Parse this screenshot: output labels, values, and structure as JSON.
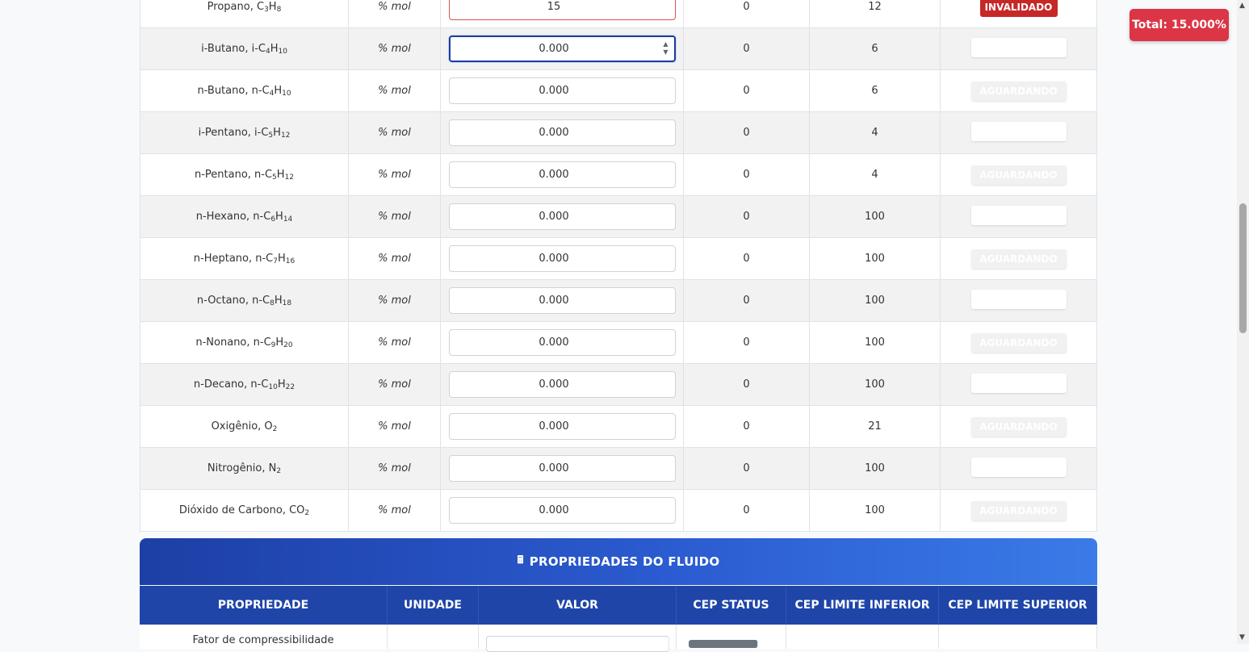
{
  "total_badge": "Total: 15.000%",
  "components": [
    {
      "name": "Propano, C",
      "f": [
        [
          "3",
          "sub"
        ],
        [
          "H",
          ""
        ],
        [
          "8",
          "sub"
        ]
      ],
      "unit": "% mol",
      "value": "15",
      "lower": "0",
      "upper": "12",
      "status": "INVALIDADO",
      "state": "invalid"
    },
    {
      "name": "i-Butano, i-C",
      "f": [
        [
          "4",
          "sub"
        ],
        [
          "H",
          ""
        ],
        [
          "10",
          "sub"
        ]
      ],
      "unit": "% mol",
      "value": "0.000",
      "lower": "0",
      "upper": "6",
      "status": "",
      "state": "focused"
    },
    {
      "name": "n-Butano, n-C",
      "f": [
        [
          "4",
          "sub"
        ],
        [
          "H",
          ""
        ],
        [
          "10",
          "sub"
        ]
      ],
      "unit": "% mol",
      "value": "0.000",
      "lower": "0",
      "upper": "6",
      "status": "AGUARDANDO",
      "state": "waiting"
    },
    {
      "name": "i-Pentano, i-C",
      "f": [
        [
          "5",
          "sub"
        ],
        [
          "H",
          ""
        ],
        [
          "12",
          "sub"
        ]
      ],
      "unit": "% mol",
      "value": "0.000",
      "lower": "0",
      "upper": "4",
      "status": "",
      "state": "blank"
    },
    {
      "name": "n-Pentano, n-C",
      "f": [
        [
          "5",
          "sub"
        ],
        [
          "H",
          ""
        ],
        [
          "12",
          "sub"
        ]
      ],
      "unit": "% mol",
      "value": "0.000",
      "lower": "0",
      "upper": "4",
      "status": "AGUARDANDO",
      "state": "waiting"
    },
    {
      "name": "n-Hexano, n-C",
      "f": [
        [
          "6",
          "sub"
        ],
        [
          "H",
          ""
        ],
        [
          "14",
          "sub"
        ]
      ],
      "unit": "% mol",
      "value": "0.000",
      "lower": "0",
      "upper": "100",
      "status": "",
      "state": "blank"
    },
    {
      "name": "n-Heptano, n-C",
      "f": [
        [
          "7",
          "sub"
        ],
        [
          "H",
          ""
        ],
        [
          "16",
          "sub"
        ]
      ],
      "unit": "% mol",
      "value": "0.000",
      "lower": "0",
      "upper": "100",
      "status": "AGUARDANDO",
      "state": "waiting"
    },
    {
      "name": "n-Octano, n-C",
      "f": [
        [
          "8",
          "sub"
        ],
        [
          "H",
          ""
        ],
        [
          "18",
          "sub"
        ]
      ],
      "unit": "% mol",
      "value": "0.000",
      "lower": "0",
      "upper": "100",
      "status": "",
      "state": "blank"
    },
    {
      "name": "n-Nonano, n-C",
      "f": [
        [
          "9",
          "sub"
        ],
        [
          "H",
          ""
        ],
        [
          "20",
          "sub"
        ]
      ],
      "unit": "% mol",
      "value": "0.000",
      "lower": "0",
      "upper": "100",
      "status": "AGUARDANDO",
      "state": "waiting"
    },
    {
      "name": "n-Decano, n-C",
      "f": [
        [
          "10",
          "sub"
        ],
        [
          "H",
          ""
        ],
        [
          "22",
          "sub"
        ]
      ],
      "unit": "% mol",
      "value": "0.000",
      "lower": "0",
      "upper": "100",
      "status": "",
      "state": "blank"
    },
    {
      "name": "Oxigênio, O",
      "f": [
        [
          "2",
          "sub"
        ]
      ],
      "unit": "% mol",
      "value": "0.000",
      "lower": "0",
      "upper": "21",
      "status": "AGUARDANDO",
      "state": "waiting"
    },
    {
      "name": "Nitrogênio, N",
      "f": [
        [
          "2",
          "sub"
        ]
      ],
      "unit": "% mol",
      "value": "0.000",
      "lower": "0",
      "upper": "100",
      "status": "",
      "state": "blank"
    },
    {
      "name": "Dióxido de Carbono, CO",
      "f": [
        [
          "2",
          "sub"
        ]
      ],
      "unit": "% mol",
      "value": "0.000",
      "lower": "0",
      "upper": "100",
      "status": "AGUARDANDO",
      "state": "waiting"
    }
  ],
  "fluid_section": {
    "title": "PROPRIEDADES DO FLUIDO",
    "icon": "calculator-icon",
    "headers": [
      "PROPRIEDADE",
      "UNIDADE",
      "VALOR",
      "CEP STATUS",
      "CEP LIMITE INFERIOR",
      "CEP LIMITE SUPERIOR"
    ],
    "first_row_label": "Fator de compressibilidade"
  },
  "colors": {
    "header_dark": "#1d3fa5",
    "header_light": "#3a7be8",
    "invalid": "#c62828",
    "total": "#dc3545"
  }
}
